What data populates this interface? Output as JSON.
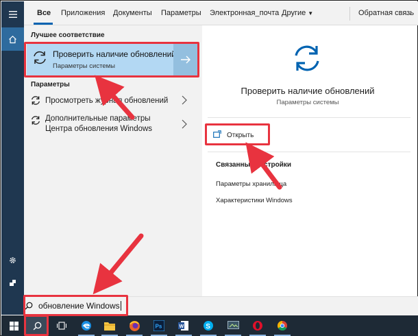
{
  "colors": {
    "accent": "#0063b1",
    "rail": "#1f3750",
    "best_match_bg": "#b3d8f3",
    "annotation_red": "#e8333f",
    "taskbar": "#1e2a36"
  },
  "tabs": [
    {
      "label": "Все",
      "selected": true
    },
    {
      "label": "Приложения"
    },
    {
      "label": "Документы"
    },
    {
      "label": "Параметры"
    },
    {
      "label": "Электронная_почта"
    },
    {
      "label": "Другие"
    },
    {
      "label": "Обратная связь"
    }
  ],
  "left_pane": {
    "best_match_heading": "Лучшее соответствие",
    "best_match": {
      "title": "Проверить наличие обновлений",
      "subtitle": "Параметры системы",
      "icon": "refresh-icon"
    },
    "settings_heading": "Параметры",
    "results": [
      {
        "line1": "Просмотреть журнал обновлений",
        "line2": "",
        "icon": "refresh-icon"
      },
      {
        "line1": "Дополнительные параметры",
        "line2": "Центра обновления Windows",
        "icon": "refresh-icon"
      }
    ]
  },
  "preview": {
    "title": "Проверить наличие обновлений",
    "subtitle": "Параметры системы",
    "open_label": "Открыть",
    "related_heading": "Связанные настройки",
    "related": [
      "Параметры хранилища",
      "Характеристики Windows"
    ]
  },
  "search": {
    "value": "обновление Windows"
  },
  "rail_icons": [
    "hamburger-icon",
    "home-icon",
    "gear-icon",
    "user-icon"
  ],
  "taskbar_icons": [
    "windows-start-icon",
    "search-icon",
    "task-view-icon",
    "edge-icon",
    "file-explorer-icon",
    "firefox-icon",
    "photoshop-icon",
    "word-icon",
    "skype-icon",
    "screen-capture-icon",
    "opera-icon",
    "chrome-icon"
  ]
}
